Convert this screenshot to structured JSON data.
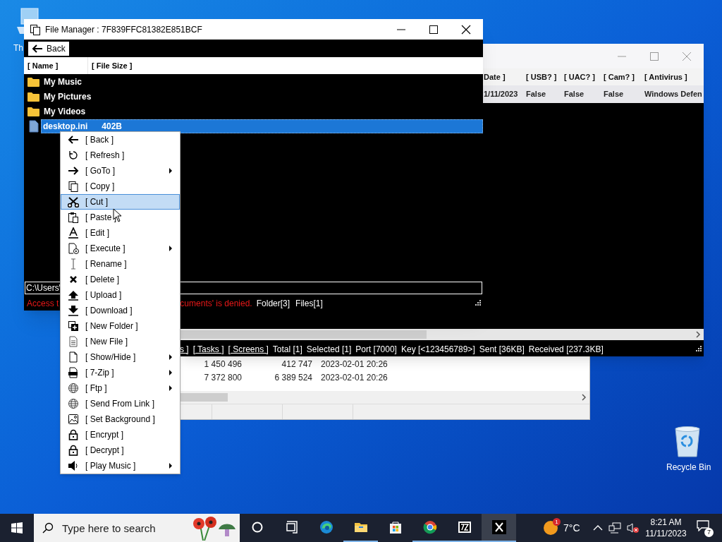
{
  "desktop_icons": [
    {
      "kind": "pc",
      "label": "Th"
    },
    {
      "kind": "recycle",
      "label": "Recycle Bin"
    }
  ],
  "back_window": {
    "rows": [
      [
        "1 450 496",
        "412 747",
        "2023-02-01 20:26"
      ],
      [
        "7 372 800",
        "6 389 524",
        "2023-02-01 20:26"
      ]
    ]
  },
  "client_window": {
    "columns": [
      "Date ]",
      "[ USB? ]",
      "[ UAC? ]",
      "[ Cam? ]",
      "[ Antivirus ]"
    ],
    "row": [
      "1/11/2023",
      "False",
      "False",
      "False",
      "Windows Defen"
    ],
    "status_items": [
      {
        "kind": "link",
        "text": "s ]"
      },
      {
        "kind": "link",
        "text": "[ Tasks ]"
      },
      {
        "kind": "link",
        "text": "[ Screens ]"
      },
      {
        "kind": "text",
        "text": "Total [1]"
      },
      {
        "kind": "text",
        "text": "Selected [1]"
      },
      {
        "kind": "text",
        "text": "Port [7000]"
      },
      {
        "kind": "text",
        "text": "Key [<123456789>]"
      },
      {
        "kind": "text",
        "text": "Sent [36KB]"
      },
      {
        "kind": "text",
        "text": "Received [237.3KB]"
      }
    ]
  },
  "file_manager": {
    "title": "File Manager : 7F839FFC81382E851BCF",
    "back_button": "Back",
    "columns": [
      "[ Name ]",
      "[ File Size ]"
    ],
    "rows": [
      {
        "kind": "folder",
        "name": "My Music",
        "selected": false
      },
      {
        "kind": "folder",
        "name": "My Pictures",
        "selected": false
      },
      {
        "kind": "folder",
        "name": "My Videos",
        "selected": false
      },
      {
        "kind": "file",
        "name": "desktop.ini",
        "size": "402B",
        "selected": true
      }
    ],
    "path": "C:\\Users\\",
    "error_parts": [
      "Access t",
      "cuments' is denied."
    ],
    "folders": "Folder[3]",
    "files": "Files[1]"
  },
  "context_menu": [
    {
      "kind": "back",
      "label": "[ Back ]",
      "submenu": false,
      "selected": false
    },
    {
      "kind": "refresh",
      "label": "[ Refresh ]",
      "submenu": false,
      "selected": false
    },
    {
      "kind": "goto",
      "label": "[ GoTo ]",
      "submenu": true,
      "selected": false
    },
    {
      "kind": "copy",
      "label": "[ Copy ]",
      "submenu": false,
      "selected": false
    },
    {
      "kind": "cut",
      "label": "[ Cut ]",
      "submenu": false,
      "selected": true
    },
    {
      "kind": "paste",
      "label": "[ Paste ]",
      "submenu": false,
      "selected": false
    },
    {
      "kind": "edit",
      "label": "[ Edit ]",
      "submenu": false,
      "selected": false
    },
    {
      "kind": "execute",
      "label": "[ Execute ]",
      "submenu": true,
      "selected": false
    },
    {
      "kind": "rename",
      "label": "[ Rename ]",
      "submenu": false,
      "selected": false
    },
    {
      "kind": "delete",
      "label": "[ Delete ]",
      "submenu": false,
      "selected": false
    },
    {
      "kind": "upload",
      "label": "[ Upload ]",
      "submenu": false,
      "selected": false
    },
    {
      "kind": "download",
      "label": "[ Download ]",
      "submenu": false,
      "selected": false
    },
    {
      "kind": "newfolder",
      "label": "[ New Folder ]",
      "submenu": false,
      "selected": false
    },
    {
      "kind": "newfile",
      "label": "[ New File ]",
      "submenu": false,
      "selected": false
    },
    {
      "kind": "page",
      "label": "[ Show/Hide ]",
      "submenu": true,
      "selected": false
    },
    {
      "kind": "zip",
      "label": "[ 7-Zip ]",
      "submenu": true,
      "selected": false
    },
    {
      "kind": "globe",
      "label": "[ Ftp ]",
      "submenu": true,
      "selected": false
    },
    {
      "kind": "globe",
      "label": "[ Send From Link ]",
      "submenu": false,
      "selected": false
    },
    {
      "kind": "image",
      "label": "[ Set Background ]",
      "submenu": false,
      "selected": false
    },
    {
      "kind": "lock",
      "label": "[ Encrypt ]",
      "submenu": false,
      "selected": false
    },
    {
      "kind": "lock",
      "label": "[ Decrypt ]",
      "submenu": false,
      "selected": false
    },
    {
      "kind": "music",
      "label": "[ Play Music ]",
      "submenu": true,
      "selected": false
    }
  ],
  "taskbar": {
    "search_placeholder": "Type here to search",
    "apps": [
      {
        "kind": "cortana",
        "running": false,
        "selected": false
      },
      {
        "kind": "taskview",
        "running": false,
        "selected": false
      },
      {
        "kind": "edge",
        "running": false,
        "selected": false
      },
      {
        "kind": "explorer",
        "running": true,
        "selected": false
      },
      {
        "kind": "store",
        "running": false,
        "selected": false
      },
      {
        "kind": "chrome",
        "running": true,
        "selected": false
      },
      {
        "kind": "sevenzip",
        "running": true,
        "selected": false
      },
      {
        "kind": "x",
        "running": true,
        "selected": true
      }
    ],
    "weather_badge": "1",
    "temperature": "7°C",
    "time": "8:21 AM",
    "date": "11/11/2023",
    "notifications": "7"
  }
}
